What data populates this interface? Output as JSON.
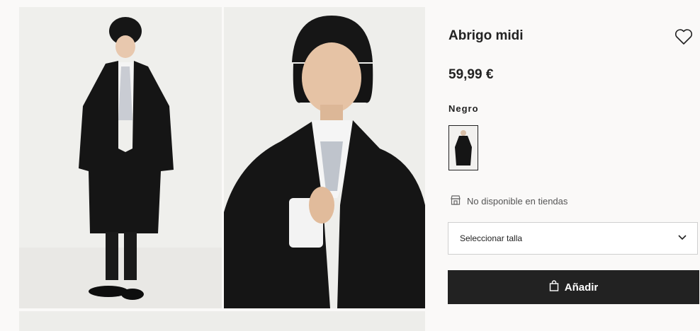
{
  "product": {
    "title": "Abrigo midi",
    "price": "59,99 €",
    "color_label": "Negro",
    "availability": "No disponible en tiendas"
  },
  "size_select": {
    "label": "Seleccionar talla"
  },
  "add_button": {
    "label": "Añadir"
  },
  "icons": [
    "heart-icon",
    "store-icon",
    "chevron-down-icon",
    "shopping-bag-icon"
  ],
  "colors": {
    "primary": "#222222",
    "background": "#faf9f8",
    "coat": "#151515"
  }
}
